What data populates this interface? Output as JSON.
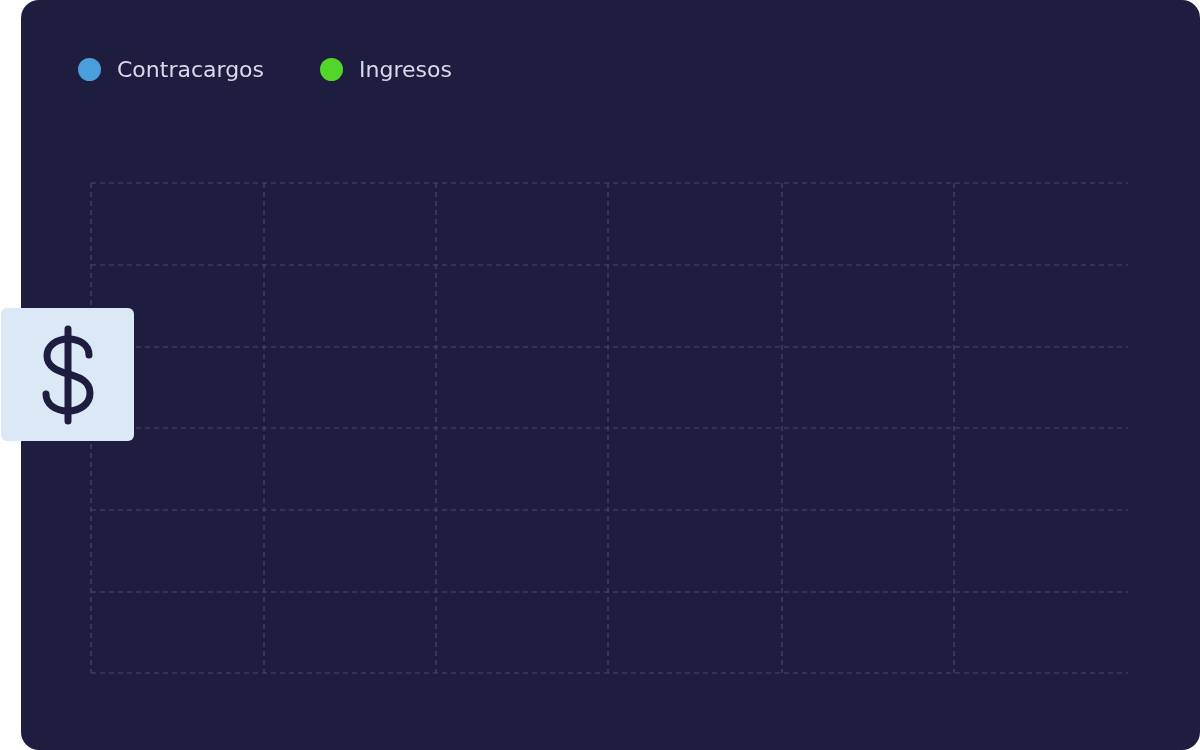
{
  "legend": [
    {
      "label": "Contracargos",
      "color": "#4a9fdb"
    },
    {
      "label": "Ingresos",
      "color": "#52d62a"
    }
  ]
}
